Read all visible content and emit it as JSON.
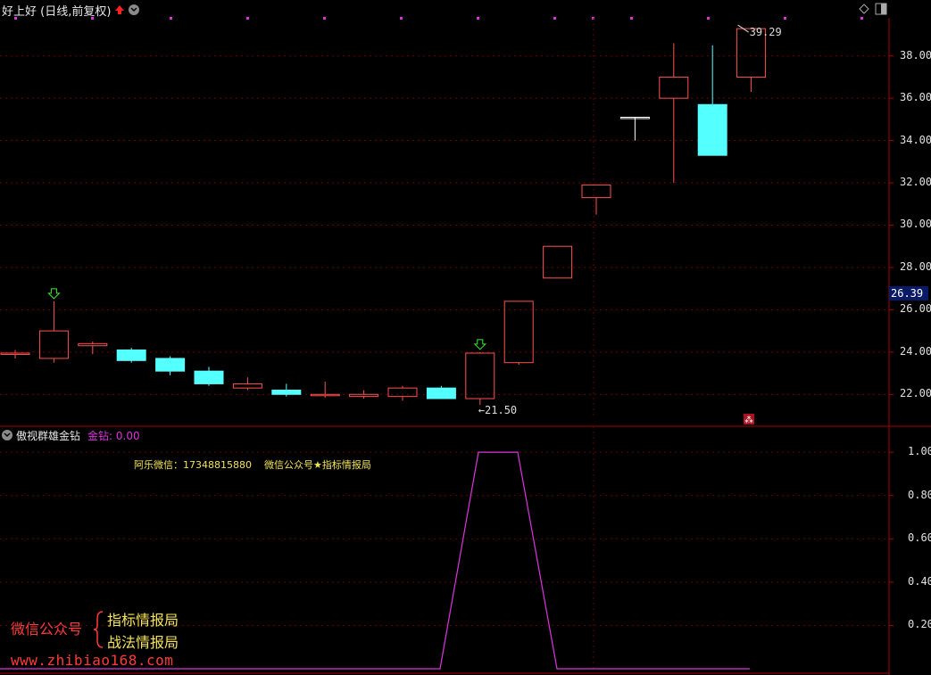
{
  "header": {
    "title": "好上好 (日线,前复权)",
    "up_icon": "up-arrow-icon",
    "dropdown_icon": "chevron-down-icon"
  },
  "top_right": {
    "diamond_icon": "diamond-icon",
    "window_icon": "window-toggle-icon"
  },
  "price_axis": {
    "labels": [
      "38.00",
      "36.00",
      "34.00",
      "32.00",
      "30.00",
      "28.00",
      "26.00",
      "24.00",
      "22.00"
    ],
    "current_price": "26.39"
  },
  "indicator": {
    "name": "傲视群雄金钻",
    "value_label": "金钻: 0.00",
    "axis_labels": [
      "1.00",
      "0.80",
      "0.60",
      "0.40",
      "0.20"
    ],
    "annotation": "阿乐微信：17348815880    微信公众号★指标情报局"
  },
  "promo": {
    "left_text": "微信公众号",
    "line1": "指标情报局",
    "line2": "战法情报局",
    "url": "www.zhibiao168.com"
  },
  "colors": {
    "up": "#ff5050",
    "down": "#54ffff",
    "grid": "#6a0000",
    "signal": "#dd33dd",
    "arrow": "#33ee33"
  },
  "chart_data": [
    {
      "type": "candlestick",
      "title": "好上好 (日线,前复权)",
      "ylim": [
        21,
        39.8
      ],
      "candles": [
        {
          "o": 23.9,
          "h": 24.1,
          "l": 23.7,
          "c": 23.95
        },
        {
          "o": 23.7,
          "h": 26.4,
          "l": 23.5,
          "c": 25.0
        },
        {
          "o": 24.3,
          "h": 24.5,
          "l": 23.9,
          "c": 24.4
        },
        {
          "o": 24.1,
          "h": 24.2,
          "l": 23.5,
          "c": 23.6
        },
        {
          "o": 23.7,
          "h": 23.8,
          "l": 22.9,
          "c": 23.1
        },
        {
          "o": 23.1,
          "h": 23.3,
          "l": 22.4,
          "c": 22.5
        },
        {
          "o": 22.3,
          "h": 22.8,
          "l": 22.2,
          "c": 22.5
        },
        {
          "o": 22.2,
          "h": 22.5,
          "l": 21.9,
          "c": 22.0
        },
        {
          "o": 21.95,
          "h": 22.6,
          "l": 21.85,
          "c": 22.0
        },
        {
          "o": 21.9,
          "h": 22.2,
          "l": 21.8,
          "c": 22.0
        },
        {
          "o": 21.9,
          "h": 22.4,
          "l": 21.7,
          "c": 22.3
        },
        {
          "o": 22.3,
          "h": 22.4,
          "l": 21.8,
          "c": 21.8
        },
        {
          "o": 21.8,
          "h": 24.0,
          "l": 21.5,
          "c": 23.95
        },
        {
          "o": 23.5,
          "h": 26.4,
          "l": 23.4,
          "c": 26.4
        },
        {
          "o": 27.5,
          "h": 29.0,
          "l": 27.5,
          "c": 29.0
        },
        {
          "o": 31.3,
          "h": 31.9,
          "l": 30.5,
          "c": 31.9
        },
        {
          "o": 35.1,
          "h": 35.1,
          "l": 34.0,
          "c": 35.1
        },
        {
          "o": 36.0,
          "h": 38.6,
          "l": 32.0,
          "c": 37.0
        },
        {
          "o": 35.7,
          "h": 38.5,
          "l": 33.3,
          "c": 33.3
        },
        {
          "o": 37.0,
          "h": 39.29,
          "l": 36.3,
          "c": 39.29
        }
      ],
      "labels": [
        {
          "text": "39.29",
          "candle": 19
        },
        {
          "text": "←21.50",
          "candle": 12
        }
      ],
      "down_arrows": [
        1,
        12
      ]
    },
    {
      "type": "line",
      "series_values": [
        0,
        0,
        0,
        0,
        0,
        0,
        0,
        0,
        0,
        0,
        0,
        0,
        1,
        1,
        0,
        0,
        0,
        0,
        0,
        0
      ],
      "ylim": [
        0,
        1.05
      ]
    }
  ]
}
